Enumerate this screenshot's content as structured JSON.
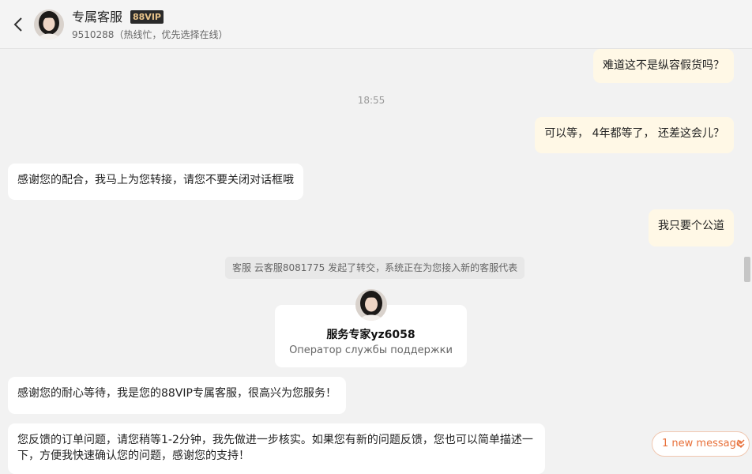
{
  "header": {
    "title": "专属客服",
    "badge": "88VIP",
    "subtitle": "9510288（热线忙，优先选择在线）"
  },
  "messages": {
    "m1": "难道这不是纵容假货吗？",
    "time1": "18:55",
    "m2": "可以等， 4年都等了， 还差这会儿？",
    "m3": "感谢您的配合，我马上为您转接，请您不要关闭对话框哦",
    "m4": "我只要个公道",
    "system": "客服 云客服8081775 发起了转交，系统正在为您接入新的客服代表",
    "m5": "感谢您的耐心等待，我是您的88VIP专属客服，很高兴为您服务！",
    "m6": "您反馈的订单问题，请您稍等1-2分钟，我先做进一步核实。如果您有新的问题反馈，您也可以简单描述一下，方便我快速确认您的问题，感谢您的支持！"
  },
  "agent": {
    "name": "服务专家yz6058",
    "role": "Оператор службы поддержки"
  },
  "new_message": "1 new message",
  "colors": {
    "my_bubble": "#fff8e6",
    "their_bubble": "#ffffff",
    "accent": "#e8703a",
    "vip_gold": "#e9c48a"
  },
  "icons": {
    "back": "chevron-left-icon",
    "new_message": "double-chevron-down-icon"
  }
}
